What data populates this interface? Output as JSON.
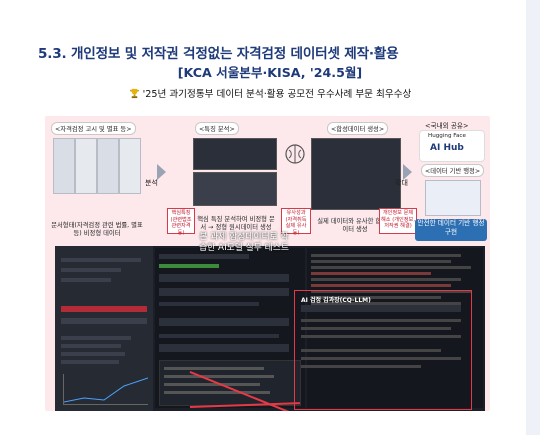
{
  "title": "5.3. 개인정보 및 저작권 걱정없는 자격검정 데이터셋 제작·활용",
  "subtitle": "[KCA 서울본부·KISA, '24.5월]",
  "award": "'25년 과기정통부 데이터 분석·활용 공모전 우수사례 부문 최우수상",
  "award_icon": "trophy-icon",
  "flow": {
    "step1_title": "<자격검정 고시 및 별표 등>",
    "step2_title": "<특징 분석>",
    "step3_title": "<합성데이터 생성>",
    "step4_title": "<국내외 공유>",
    "step4_sub": "<데이터 기반 행정>",
    "arrow_label_1": "분석",
    "arrow_label_2": "확대",
    "hf_line1": "Hugging Face",
    "hf_line2": "AI Hub",
    "cap1": "문서형태(자격검정 관련 법률, 별표 등) 비정형 데이터",
    "cap2": "핵심 특징 분석하여 비정형 문서 → 정형 원시데이터 생성",
    "cap3": "실제 데이터와 유사한 합성데이터 생성",
    "cap4": "안전한 데이터 기반 행정 구현",
    "tag1": "핵심특징 (관련법조 관련자격 등)",
    "tag2": "유사성과 (자격취득 실제 유사 등)",
    "tag3": "개인정보 문제 해소 (개인정보, 저작권 해결)"
  },
  "screens": {
    "overlay_text": "본 과제 합성데이터로 학습한 AI모델 실무 테스트",
    "ai_panel_title": "AI 검정 김과장(CQ-LLM)"
  },
  "colors": {
    "heading": "#1f3a7a",
    "poster_bg": "#fde9ec",
    "accent_red": "#e63946",
    "blue_box": "#2d6fb3"
  }
}
